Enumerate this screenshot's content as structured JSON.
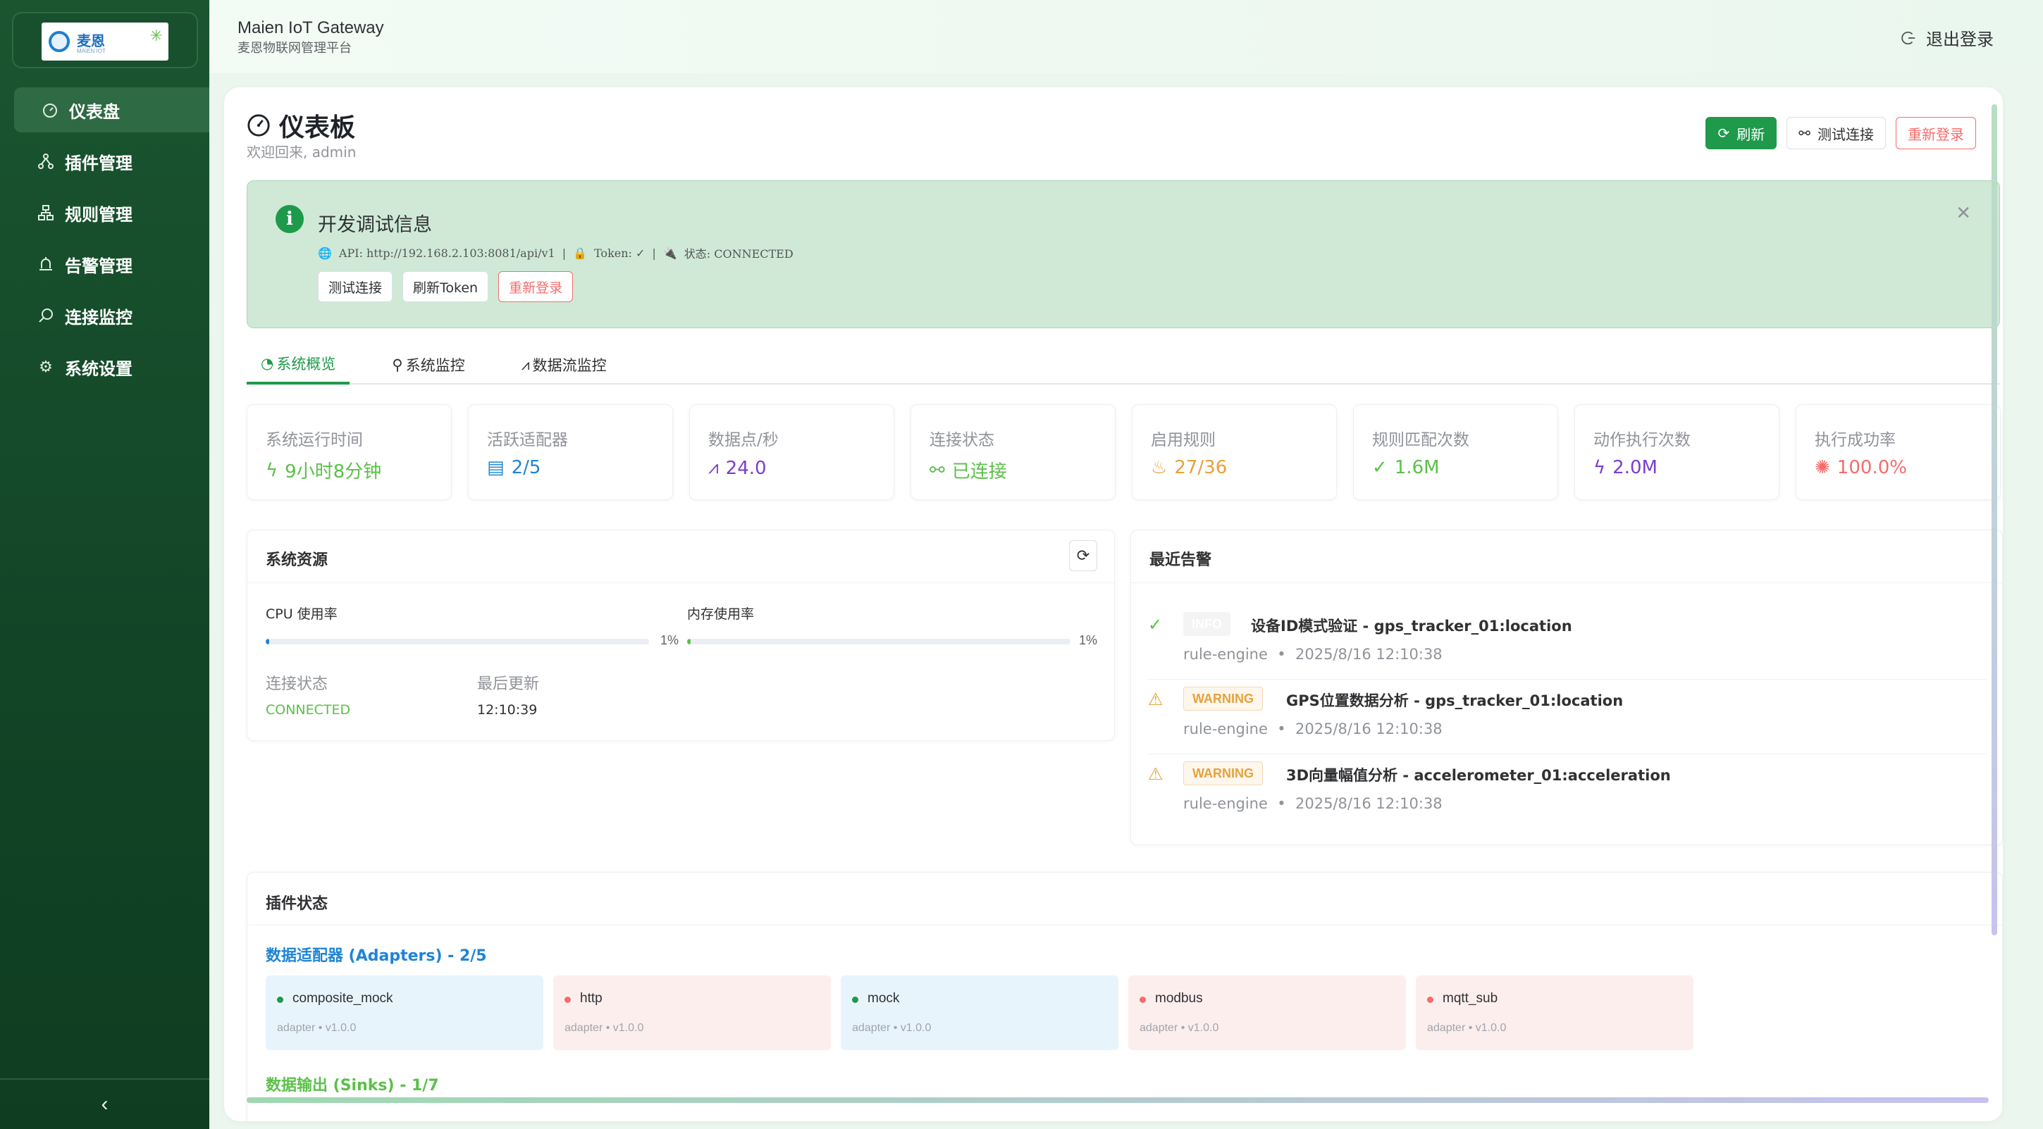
{
  "colors": {
    "primary": "#1e9a4a",
    "danger": "#f56c6c",
    "warning": "#e6a23c",
    "blue": "#1f84d8",
    "purple": "#7a3fd1",
    "sidebar": "#124426"
  },
  "brand": {
    "logo_text": "麦恩",
    "logo_sub": "MAIEN IOT"
  },
  "sidebar": {
    "items": [
      {
        "label": "仪表盘",
        "icon": "dashboard-icon"
      },
      {
        "label": "插件管理",
        "icon": "plugin-icon"
      },
      {
        "label": "规则管理",
        "icon": "rules-icon"
      },
      {
        "label": "告警管理",
        "icon": "alarm-icon"
      },
      {
        "label": "连接监控",
        "icon": "monitor-icon"
      },
      {
        "label": "系统设置",
        "icon": "gear-icon"
      }
    ],
    "collapse_icon": "‹"
  },
  "header": {
    "title": "Maien IoT Gateway",
    "subtitle": "麦恩物联网管理平台",
    "logout_label": "退出登录"
  },
  "page": {
    "title": "仪表板",
    "subtitle": "欢迎回来, admin",
    "actions": {
      "refresh": "刷新",
      "test": "测试连接",
      "relogin": "重新登录"
    }
  },
  "debug": {
    "title": "开发调试信息",
    "api": "API: http://192.168.2.103:8081/api/v1",
    "token": "Token: ✓",
    "status": "状态: CONNECTED",
    "buttons": {
      "test": "测试连接",
      "refresh_token": "刷新Token",
      "relogin": "重新登录"
    }
  },
  "tabs": [
    {
      "label": "系统概览",
      "icon": "dashboard-icon"
    },
    {
      "label": "系统监控",
      "icon": "monitor-icon"
    },
    {
      "label": "数据流监控",
      "icon": "line-chart-icon"
    }
  ],
  "stats": [
    {
      "label": "系统运行时间",
      "value": "9小时8分钟",
      "icon": "lightning-icon",
      "color": "#5cc04a"
    },
    {
      "label": "活跃适配器",
      "value": "2/5",
      "icon": "server-icon",
      "color": "#1f84d8"
    },
    {
      "label": "数据点/秒",
      "value": "24.0",
      "icon": "trend-icon",
      "color": "#7a3fd1"
    },
    {
      "label": "连接状态",
      "value": "已连接",
      "icon": "link-icon",
      "color": "#5cc04a"
    },
    {
      "label": "启用规则",
      "value": "27/36",
      "icon": "fire-icon",
      "color": "#e6a23c"
    },
    {
      "label": "规则匹配次数",
      "value": "1.6M",
      "icon": "check-circle-icon",
      "color": "#5cc04a"
    },
    {
      "label": "动作执行次数",
      "value": "2.0M",
      "icon": "lightning-icon",
      "color": "#7a3fd1"
    },
    {
      "label": "执行成功率",
      "value": "100.0%",
      "icon": "bug-icon",
      "color": "#f56c6c"
    }
  ],
  "resources": {
    "title": "系统资源",
    "cpu_label": "CPU 使用率",
    "cpu_pct": "1%",
    "cpu_value": 1,
    "mem_label": "内存使用率",
    "mem_pct": "1%",
    "mem_value": 1,
    "conn_label": "连接状态",
    "conn_value": "CONNECTED",
    "updated_label": "最后更新",
    "updated_value": "12:10:39"
  },
  "alerts": {
    "title": "最近告警",
    "items": [
      {
        "level": "INFO",
        "title": "设备ID模式验证 - gps_tracker_01:location",
        "source": "rule-engine",
        "time": "2025/8/16 12:10:38"
      },
      {
        "level": "WARNING",
        "title": "GPS位置数据分析 - gps_tracker_01:location",
        "source": "rule-engine",
        "time": "2025/8/16 12:10:38"
      },
      {
        "level": "WARNING",
        "title": "3D向量幅值分析 - accelerometer_01:acceleration",
        "source": "rule-engine",
        "time": "2025/8/16 12:10:38"
      }
    ]
  },
  "plugins": {
    "title": "插件状态",
    "adapters_title": "数据适配器 (Adapters) - 2/5",
    "sinks_title": "数据输出 (Sinks) - 1/7",
    "adapters": [
      {
        "name": "composite_mock",
        "meta": "adapter • v1.0.0",
        "running": true
      },
      {
        "name": "http",
        "meta": "adapter • v1.0.0",
        "running": false
      },
      {
        "name": "mock",
        "meta": "adapter • v1.0.0",
        "running": true
      },
      {
        "name": "modbus",
        "meta": "adapter • v1.0.0",
        "running": false
      },
      {
        "name": "mqtt_sub",
        "meta": "adapter • v1.0.0",
        "running": false
      }
    ]
  }
}
